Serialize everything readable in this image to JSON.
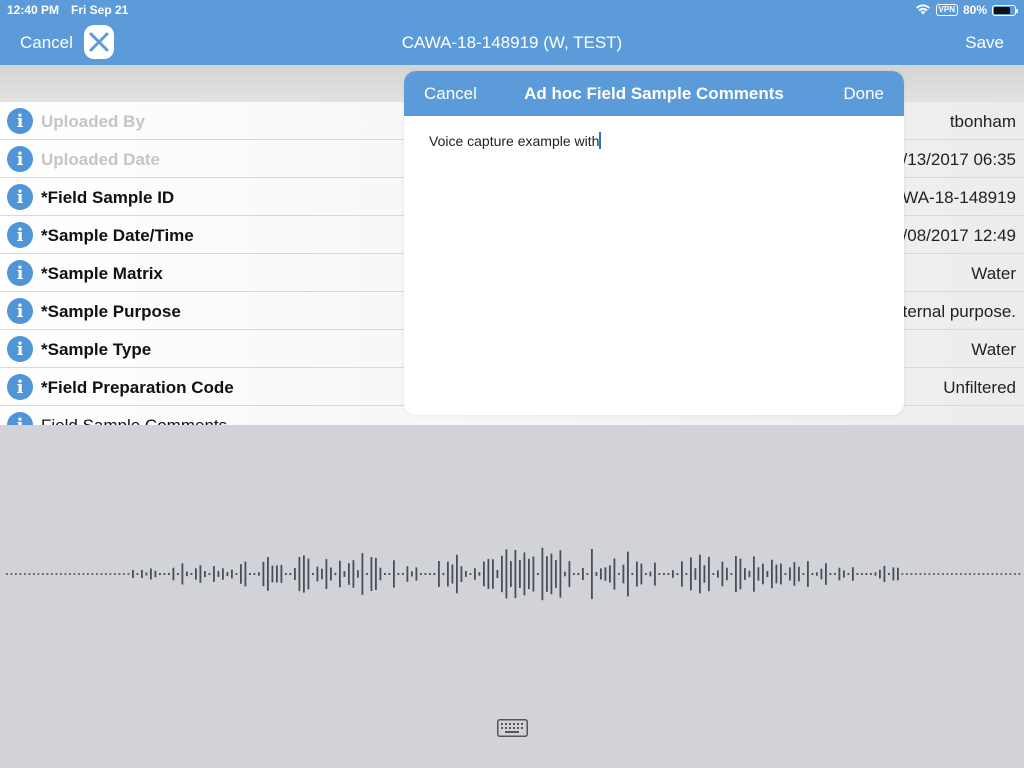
{
  "status": {
    "time": "12:40 PM",
    "date": "Fri Sep 21",
    "vpn": "VPN",
    "battery": "80%",
    "battery_level": 0.8
  },
  "nav": {
    "cancel": "Cancel",
    "title": "CAWA-18-148919 (W, TEST)",
    "save": "Save"
  },
  "rows": [
    {
      "label": "Uploaded By",
      "value": "tbonham",
      "muted": true
    },
    {
      "label": "Uploaded Date",
      "value": "/13/2017 06:35",
      "muted": true
    },
    {
      "label": "*Field Sample ID",
      "value": "WA-18-148919",
      "muted": false
    },
    {
      "label": "*Sample Date/Time",
      "value": "/08/2017 12:49",
      "muted": false
    },
    {
      "label": "*Sample Matrix",
      "value": "Water",
      "muted": false
    },
    {
      "label": "*Sample Purpose",
      "value": "ternal purpose.",
      "muted": false
    },
    {
      "label": "*Sample Type",
      "value": "Water",
      "muted": false
    },
    {
      "label": "*Field Preparation Code",
      "value": "Unfiltered",
      "muted": false
    },
    {
      "label": "Field Sample Comments",
      "value": "",
      "muted": false
    }
  ],
  "modal": {
    "cancel": "Cancel",
    "title": "Ad hoc Field Sample Comments",
    "done": "Done",
    "text": "Voice capture example with"
  },
  "icons": {
    "info": "info-icon",
    "close": "close-icon",
    "keyboard": "keyboard-icon",
    "wifi": "wifi-icon",
    "battery": "battery-icon"
  },
  "colors": {
    "accent": "#5b9bd9",
    "info": "#4f95d8",
    "dictation_bg": "#d1d3d9",
    "waveform": "#4a4d57"
  }
}
